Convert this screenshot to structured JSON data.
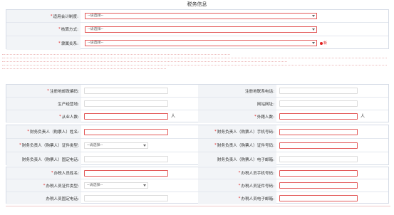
{
  "page": {
    "title": "税务信息"
  },
  "select_placeholder": "--请选择--",
  "section1": {
    "accounting_system": {
      "label": "适用会计制度:",
      "required": "*"
    },
    "settlement_method": {
      "label": "核算方式:",
      "required": "*"
    },
    "affiliation": {
      "label": "隶属关系:",
      "required": "*"
    },
    "new_badge_label": "新"
  },
  "section2": {
    "registered_capital": {
      "label": "注册地邮政编码:",
      "required": "*"
    },
    "registered_phone": {
      "label": "注册地联系电话:"
    },
    "business_place": {
      "label": "生产经营地:"
    },
    "website": {
      "label": "网站网址:"
    },
    "employees": {
      "label": "从业人数:",
      "required": "*",
      "unit": "人"
    },
    "foreign_employees": {
      "label": "外籍人数:",
      "required": "*",
      "unit": "人"
    }
  },
  "section3": {
    "finance_name": {
      "label": "财务负责人（购票人）姓名:",
      "required": "*"
    },
    "finance_mobile": {
      "label": "财务负责人（购票人）手机号码:",
      "required": "*"
    },
    "finance_id_type": {
      "label": "财务负责人（购票人）证件类型:",
      "required": "*"
    },
    "finance_id_no": {
      "label": "财务负责人（购票人）证件号码:",
      "required": "*"
    },
    "finance_phone": {
      "label": "财务负责人（购票人）固定电话:"
    },
    "finance_email": {
      "label": "财务负责人（购票人）电子邮箱:"
    }
  },
  "section4": {
    "agent_name": {
      "label": "办税人员姓名:",
      "required": "*"
    },
    "agent_mobile": {
      "label": "办税人员手机号码:",
      "required": "*"
    },
    "agent_id_type": {
      "label": "办税人员证件类型:",
      "required": "*"
    },
    "agent_id_no": {
      "label": "办税人员证件号码:",
      "required": "*"
    },
    "agent_phone": {
      "label": "办税人员固定电话:"
    },
    "agent_email": {
      "label": "办税人员电子邮箱:",
      "required": "*"
    }
  }
}
